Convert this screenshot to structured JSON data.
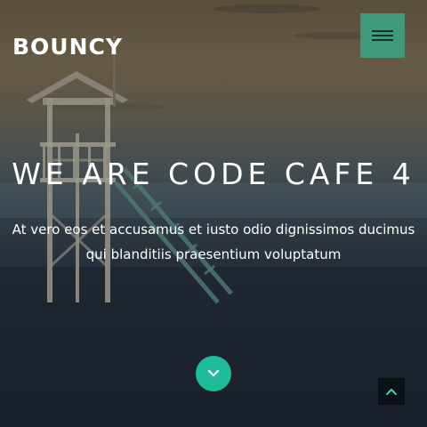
{
  "nav": {
    "brand": "BOUNCY",
    "menu_icon": "hamburger-icon"
  },
  "hero": {
    "headline": "WE ARE CODE CAFE 4",
    "subtitle_line1": "At vero eos et accusamus et iusto odio dignissimos ducimus",
    "subtitle_line2": "qui blanditiis praesentium voluptatum",
    "scroll_down_icon": "chevron-down-icon",
    "background_photo": "lifeguard-tower-on-beach-at-dusk"
  },
  "back_to_top": {
    "icon": "chevron-up-icon"
  },
  "colors": {
    "menu_button": "#3f9a7a",
    "scroll_button": "#1ebc9b",
    "back_to_top_button": "#0c1118",
    "text": "#ffffff"
  }
}
